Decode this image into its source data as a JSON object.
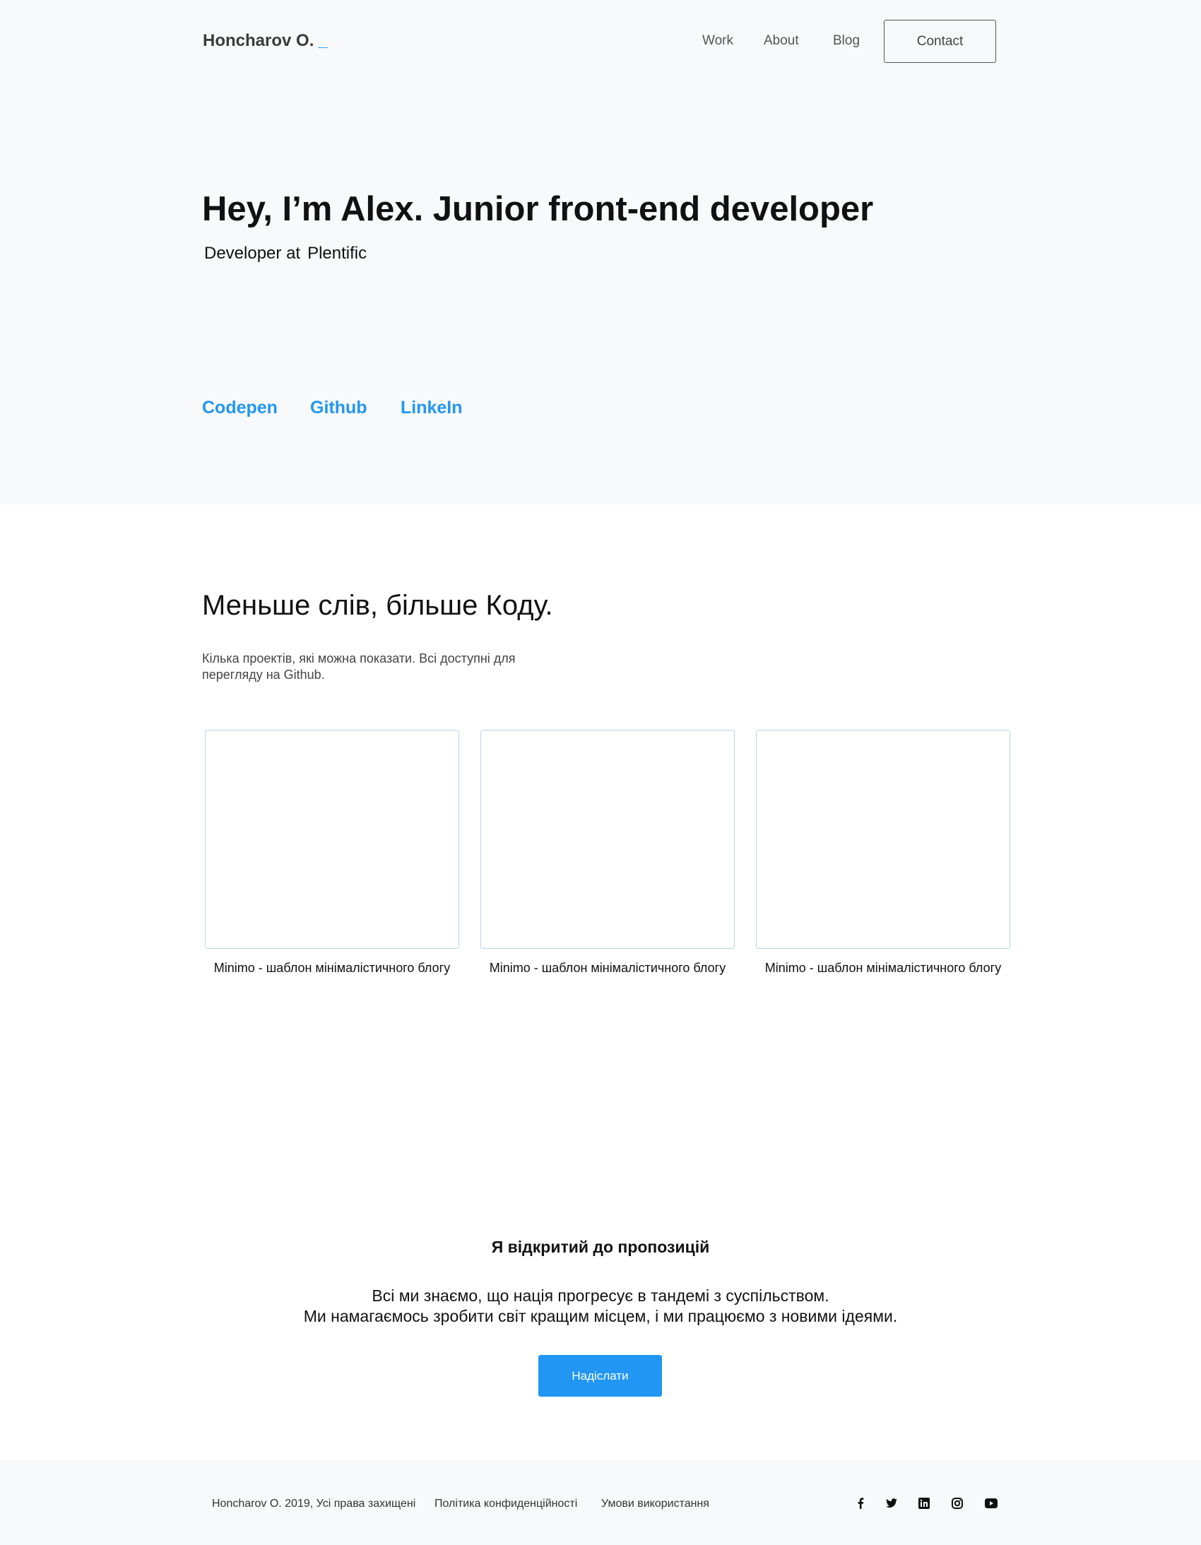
{
  "header": {
    "logo": "Honcharov O.",
    "logo_cursor": "_",
    "nav": {
      "work": "Work",
      "about": "About",
      "blog": "Blog",
      "contact": "Contact"
    }
  },
  "hero": {
    "title": "Hey, I’m Alex. Junior front-end developer",
    "subtitle_prefix": "Developer at",
    "company": "Plentific",
    "links": {
      "codepen": "Codepen",
      "github": "Github",
      "linkedin": "LinkeIn"
    }
  },
  "projects": {
    "title": "Меньше слів, більше Коду.",
    "description": "Кілька проектів, які можна показати. Всі доступні для перегляду на Github.",
    "items": [
      {
        "caption": "Minimo - шаблон мінімалістичного блогу"
      },
      {
        "caption": "Minimo - шаблон мінімалістичного блогу"
      },
      {
        "caption": "Minimo - шаблон мінімалістичного блогу"
      }
    ]
  },
  "cta": {
    "title": "Я відкритий до пропозицій",
    "line1": "Всі ми знаємо, що нація прогресує в тандемі з суспільством.",
    "line2": "Ми намагаємось зробити світ кращим місцем, і ми працюємо з новими ідеями.",
    "button": "Надіслати"
  },
  "footer": {
    "copyright": "Honcharov O. 2019, Усі права захищені",
    "privacy": "Політика конфиденційності",
    "terms": "Умови використання",
    "social_icons": [
      "facebook-icon",
      "twitter-icon",
      "linkedin-icon",
      "instagram-icon",
      "youtube-icon"
    ]
  },
  "colors": {
    "accent": "#2196f3",
    "hero_background": "#f8f9fb",
    "card_border": "#b7d3ee"
  }
}
